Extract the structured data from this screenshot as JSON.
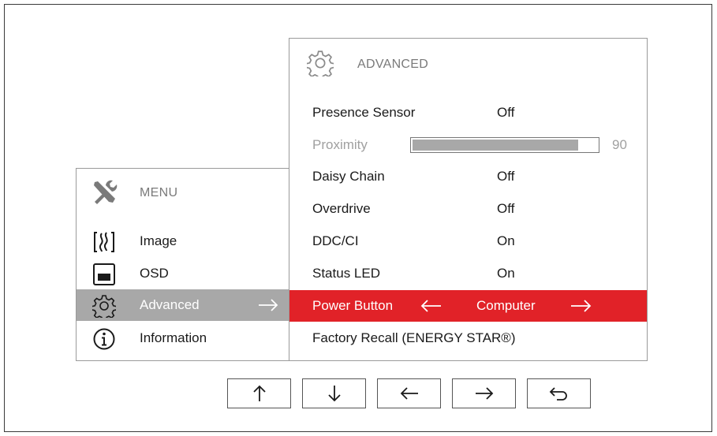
{
  "main_menu": {
    "title": "MENU",
    "header_icon": "tools-icon",
    "items": [
      {
        "label": "Image",
        "icon": "image-icon"
      },
      {
        "label": "OSD",
        "icon": "osd-icon"
      },
      {
        "label": "Advanced",
        "icon": "gear-icon",
        "active": true
      },
      {
        "label": "Information",
        "icon": "info-icon"
      }
    ]
  },
  "advanced": {
    "title": "ADVANCED",
    "header_icon": "gear-icon",
    "rows": [
      {
        "label": "Presence Sensor",
        "value": "Off"
      },
      {
        "label": "Proximity",
        "value": "90",
        "level": 90,
        "disabled": true
      },
      {
        "label": "Daisy Chain",
        "value": "Off"
      },
      {
        "label": "Overdrive",
        "value": "Off"
      },
      {
        "label": "DDC/CI",
        "value": "On"
      },
      {
        "label": "Status LED",
        "value": "On"
      },
      {
        "label": "Power Button",
        "value": "Computer",
        "selected": true
      },
      {
        "label": "Factory Recall (ENERGY STAR®)",
        "value": ""
      }
    ]
  },
  "nav_buttons": [
    "up-arrow-icon",
    "down-arrow-icon",
    "left-arrow-icon",
    "right-arrow-icon",
    "back-icon"
  ],
  "colors": {
    "accent_red": "#e12228",
    "active_gray": "#a8a8a8",
    "border_gray": "#9a9a9a",
    "muted_text": "#7a7a7a"
  }
}
